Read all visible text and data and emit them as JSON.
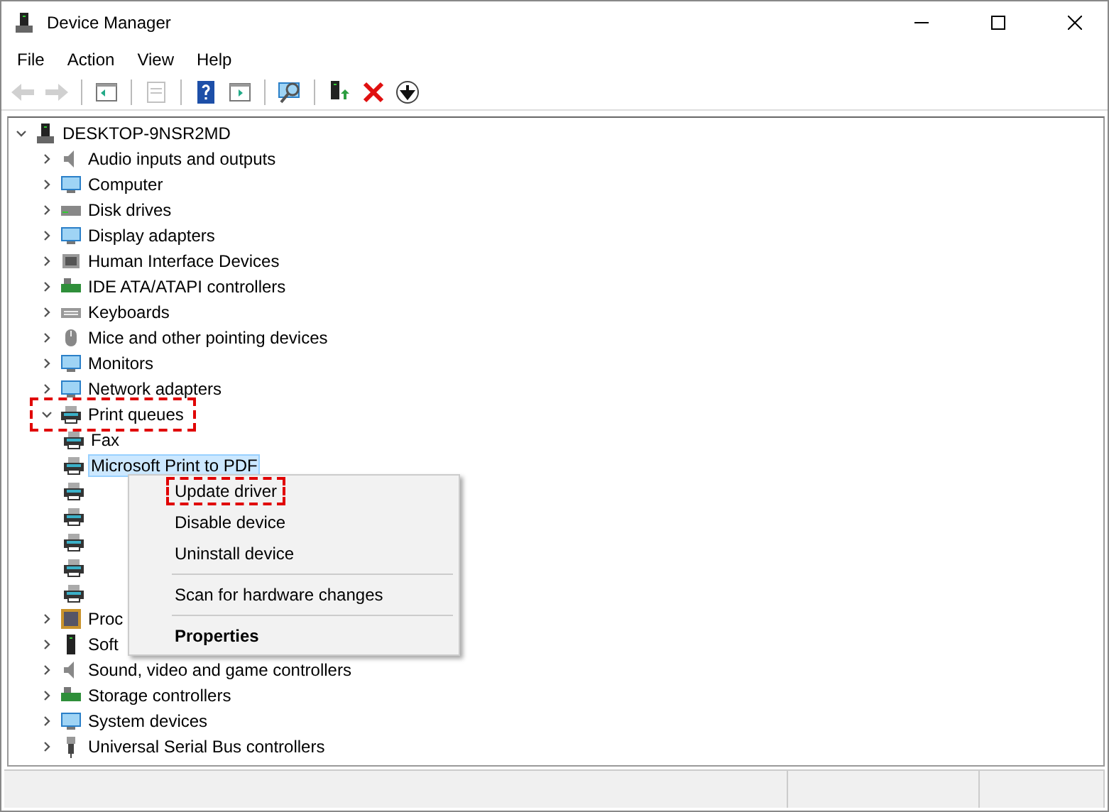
{
  "window": {
    "title": "Device Manager"
  },
  "menu_bar": [
    "File",
    "Action",
    "View",
    "Help"
  ],
  "toolbar": [
    {
      "kind": "back",
      "disabled": true
    },
    {
      "kind": "forward",
      "disabled": true
    },
    {
      "kind": "separator"
    },
    {
      "kind": "console",
      "disabled": false
    },
    {
      "kind": "separator"
    },
    {
      "kind": "properties",
      "disabled": true
    },
    {
      "kind": "separator"
    },
    {
      "kind": "help",
      "disabled": false
    },
    {
      "kind": "pane",
      "disabled": false
    },
    {
      "kind": "separator"
    },
    {
      "kind": "scan",
      "disabled": false
    },
    {
      "kind": "separator"
    },
    {
      "kind": "update",
      "disabled": false
    },
    {
      "kind": "uninstall",
      "disabled": false
    },
    {
      "kind": "download",
      "disabled": false
    }
  ],
  "tree": {
    "label": "DESKTOP-9NSR2MD",
    "kind": "computer",
    "expanded": true,
    "selected": false,
    "annotated": false,
    "children": [
      {
        "label": "Audio inputs and outputs",
        "kind": "speaker",
        "expanded": false,
        "selected": false,
        "annotated": false
      },
      {
        "label": "Computer",
        "kind": "monitor",
        "expanded": false,
        "selected": false,
        "annotated": false
      },
      {
        "label": "Disk drives",
        "kind": "disk",
        "expanded": false,
        "selected": false,
        "annotated": false
      },
      {
        "label": "Display adapters",
        "kind": "monitor",
        "expanded": false,
        "selected": false,
        "annotated": false
      },
      {
        "label": "Human Interface Devices",
        "kind": "hid",
        "expanded": false,
        "selected": false,
        "annotated": false
      },
      {
        "label": "IDE ATA/ATAPI controllers",
        "kind": "ide",
        "expanded": false,
        "selected": false,
        "annotated": false
      },
      {
        "label": "Keyboards",
        "kind": "keyboard",
        "expanded": false,
        "selected": false,
        "annotated": false
      },
      {
        "label": "Mice and other pointing devices",
        "kind": "mouse",
        "expanded": false,
        "selected": false,
        "annotated": false
      },
      {
        "label": "Monitors",
        "kind": "monitor",
        "expanded": false,
        "selected": false,
        "annotated": false
      },
      {
        "label": "Network adapters",
        "kind": "monitor",
        "expanded": false,
        "selected": false,
        "annotated": false
      },
      {
        "label": "Print queues",
        "kind": "printer",
        "expanded": true,
        "selected": false,
        "annotated": true,
        "children": [
          {
            "label": "Fax",
            "kind": "printer",
            "selected": false,
            "annotated": false
          },
          {
            "label": "Microsoft Print to PDF",
            "kind": "printer",
            "selected": true,
            "annotated": false
          },
          {
            "kind": "printer",
            "annotated": false
          },
          {
            "kind": "printer",
            "annotated": false
          },
          {
            "kind": "printer",
            "annotated": false
          },
          {
            "kind": "printer",
            "annotated": false
          },
          {
            "kind": "printer",
            "annotated": false
          }
        ]
      },
      {
        "label": "Proc",
        "kind": "chip",
        "expanded": false,
        "selected": false,
        "annotated": false
      },
      {
        "label": "Soft",
        "kind": "tower",
        "expanded": false,
        "selected": false,
        "annotated": false
      },
      {
        "label": "Sound, video and game controllers",
        "kind": "speaker",
        "expanded": false,
        "selected": false,
        "annotated": false
      },
      {
        "label": "Storage controllers",
        "kind": "ide",
        "expanded": false,
        "selected": false,
        "annotated": false
      },
      {
        "label": "System devices",
        "kind": "monitor",
        "expanded": false,
        "selected": false,
        "annotated": false
      },
      {
        "label": "Universal Serial Bus controllers",
        "kind": "usb",
        "expanded": false,
        "selected": false,
        "annotated": false
      }
    ]
  },
  "context_menu": [
    {
      "kind": "item",
      "label": "Update driver",
      "bold": false,
      "annotated": true
    },
    {
      "kind": "item",
      "label": "Disable device",
      "bold": false,
      "annotated": false
    },
    {
      "kind": "item",
      "label": "Uninstall device",
      "bold": false,
      "annotated": false
    },
    {
      "kind": "separator"
    },
    {
      "kind": "item",
      "label": "Scan for hardware changes",
      "bold": false,
      "annotated": false
    },
    {
      "kind": "separator"
    },
    {
      "kind": "item",
      "label": "Properties",
      "bold": true,
      "annotated": false
    }
  ]
}
